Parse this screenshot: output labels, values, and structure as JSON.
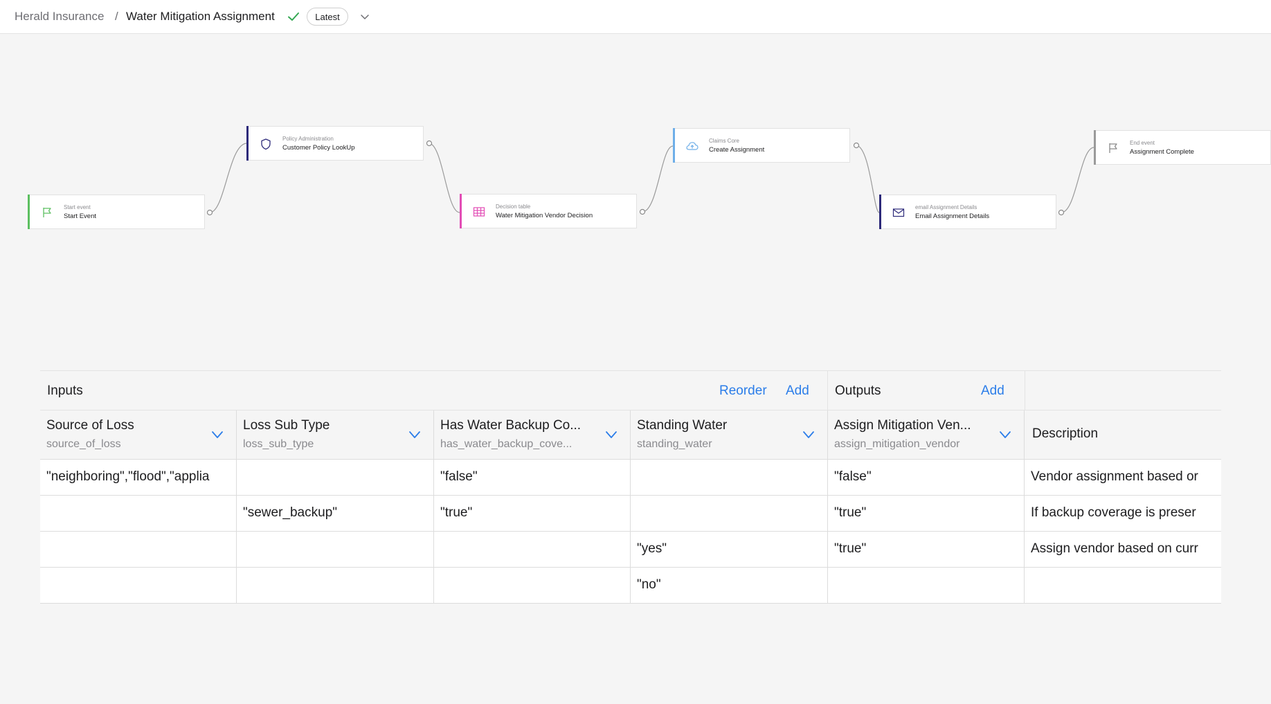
{
  "breadcrumb": {
    "root": "Herald Insurance",
    "separator": "/",
    "current": "Water Mitigation Assignment",
    "version_badge": "Latest"
  },
  "flow": {
    "nodes": [
      {
        "type": "Start event",
        "name": "Start Event",
        "icon": "flag-icon",
        "accent": "#5cbf60"
      },
      {
        "type": "Policy Administration",
        "name": "Customer Policy LookUp",
        "icon": "shield-icon",
        "accent": "#2d2a7a"
      },
      {
        "type": "Decision table",
        "name": "Water Mitigation Vendor Decision",
        "icon": "table-icon",
        "accent": "#e24cb5"
      },
      {
        "type": "Claims Core",
        "name": "Create Assignment",
        "icon": "cloud-icon",
        "accent": "#6eaee8"
      },
      {
        "type": "email Assignment Details",
        "name": "Email Assignment Details",
        "icon": "mail-icon",
        "accent": "#2d2a7a"
      },
      {
        "type": "End event",
        "name": "Assignment Complete",
        "icon": "flag-icon",
        "accent": "#9a9a9a"
      }
    ]
  },
  "decision_table": {
    "inputs_title": "Inputs",
    "outputs_title": "Outputs",
    "reorder_label": "Reorder",
    "add_label": "Add",
    "columns": [
      {
        "name": "Source of Loss",
        "expr": "source_of_loss"
      },
      {
        "name": "Loss Sub Type",
        "expr": "loss_sub_type"
      },
      {
        "name": "Has Water Backup Co...",
        "expr": "has_water_backup_cove..."
      },
      {
        "name": "Standing Water",
        "expr": "standing_water"
      },
      {
        "name": "Assign Mitigation Ven...",
        "expr": "assign_mitigation_vendor"
      }
    ],
    "description_header": "Description",
    "rows": [
      {
        "cells": [
          "\"neighboring\",\"flood\",\"applia",
          "",
          "\"false\"",
          "",
          "\"false\"",
          "Vendor assignment based or"
        ]
      },
      {
        "cells": [
          "",
          "\"sewer_backup\"",
          "\"true\"",
          "",
          "\"true\"",
          "If backup coverage is preser"
        ]
      },
      {
        "cells": [
          "",
          "",
          "",
          "\"yes\"",
          "\"true\"",
          "Assign vendor based on curr"
        ]
      },
      {
        "cells": [
          "",
          "",
          "",
          "\"no\"",
          "",
          ""
        ]
      }
    ]
  },
  "colors": {
    "link": "#2b7de9",
    "success": "#34a853"
  }
}
